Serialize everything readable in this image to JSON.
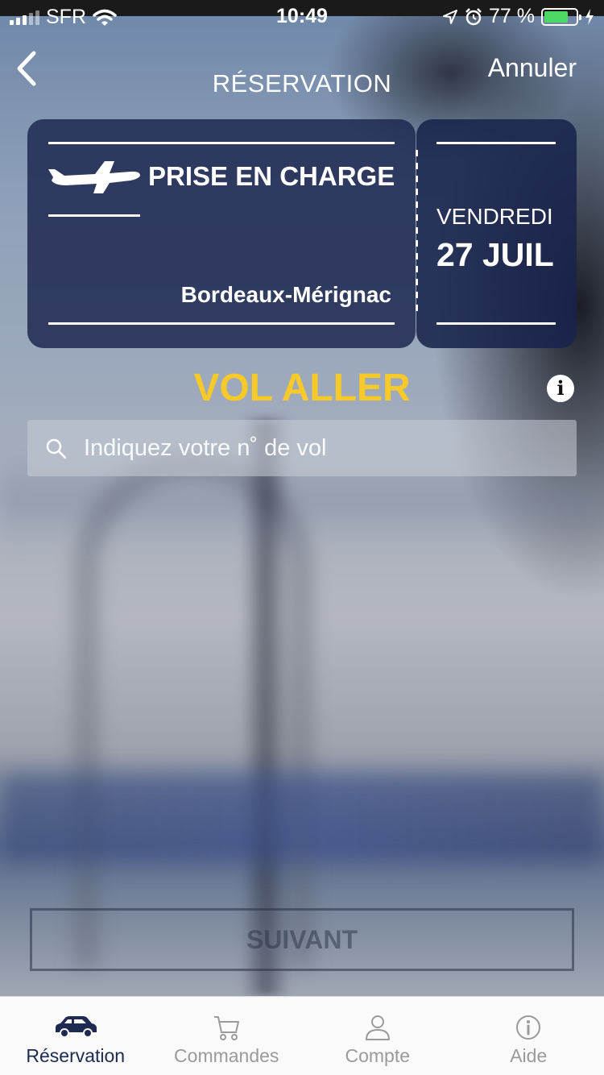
{
  "status_bar": {
    "carrier": "SFR",
    "time": "10:49",
    "battery": "77 %",
    "battery_level": 0.77
  },
  "nav": {
    "title": "RÉSERVATION",
    "cancel_label": "Annuler"
  },
  "ticket": {
    "label": "PRISE EN CHARGE",
    "location": "Bordeaux-Mérignac",
    "weekday": "VENDREDI",
    "date": "27 JUIL"
  },
  "flight": {
    "heading": "VOL ALLER",
    "info_icon": "info-icon",
    "search_placeholder": "Indiquez votre n˚ de vol",
    "search_value": ""
  },
  "next_label": "SUIVANT",
  "colors": {
    "accent": "#f7c929",
    "primary": "#1e2a50",
    "battery": "#4cd964"
  },
  "tabs": [
    {
      "label": "Réservation",
      "icon": "car-icon",
      "active": true
    },
    {
      "label": "Commandes",
      "icon": "cart-icon",
      "active": false
    },
    {
      "label": "Compte",
      "icon": "user-icon",
      "active": false
    },
    {
      "label": "Aide",
      "icon": "info-icon",
      "active": false
    }
  ]
}
